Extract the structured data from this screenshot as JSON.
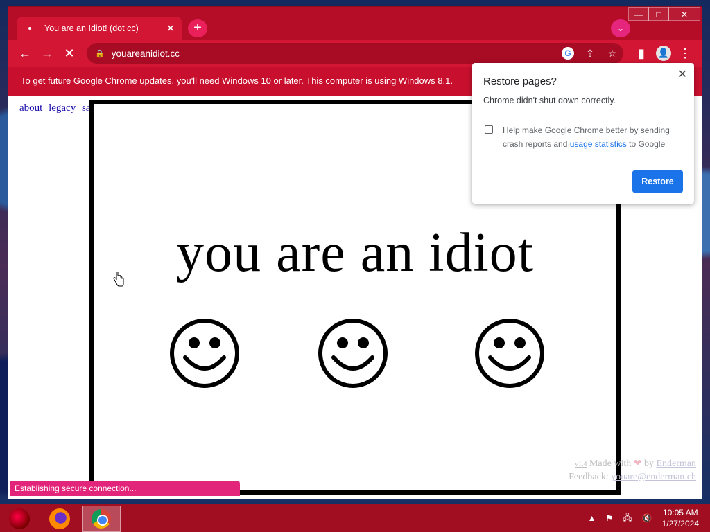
{
  "tab": {
    "title": "You are an Idiot! (dot cc)",
    "close": "✕"
  },
  "tabstrip": {
    "new_tab": "+",
    "tab_search": "⌄"
  },
  "window_controls": {
    "minimize": "—",
    "maximize": "□",
    "close": "✕"
  },
  "toolbar": {
    "back": "←",
    "forward": "→",
    "stop": "✕",
    "url": "youareanidiot.cc",
    "google_badge": "G",
    "share": "⇪",
    "bookmark": "☆",
    "side_panel": "▮",
    "menu": "⋮"
  },
  "infobar": {
    "text": "To get future Google Chrome updates, you'll need Windows 10 or later. This computer is using Windows 8.1."
  },
  "page": {
    "links": [
      "about",
      "legacy",
      "safe"
    ],
    "headline": "you are an idiot",
    "credits": {
      "version": "v1.4",
      "made_with": "Made with",
      "by": "by",
      "author": "Enderman",
      "feedback_label": "Feedback:",
      "feedback_email": "youare@enderman.ch"
    }
  },
  "status": {
    "text": "Establishing secure connection..."
  },
  "dialog": {
    "title": "Restore pages?",
    "message": "Chrome didn't shut down correctly.",
    "checkbox_text_before": "Help make Google Chrome better by sending crash reports and",
    "checkbox_link": "usage statistics",
    "checkbox_text_after": "to Google",
    "button": "Restore",
    "close": "✕"
  },
  "taskbar": {
    "apps": [
      "start",
      "firefox",
      "chrome"
    ],
    "tray_chevron": "▲",
    "time": "10:05 AM",
    "date": "1/27/2024"
  },
  "colors": {
    "theme_red": "#c8102e",
    "tab_active": "#d31634",
    "accent_pink": "#e3247b",
    "dialog_button": "#1a73e8"
  }
}
